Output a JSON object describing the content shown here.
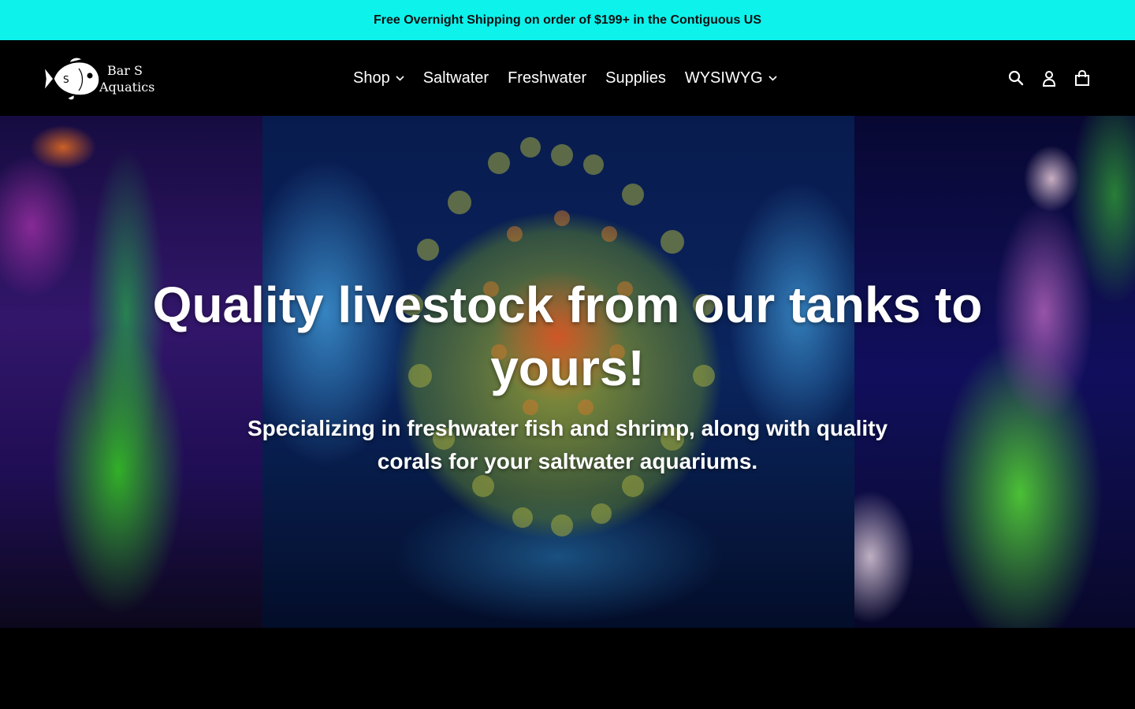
{
  "announcement": {
    "text": "Free Overnight Shipping on order of $199+ in the Contiguous US",
    "background": "#0ef2ec"
  },
  "header": {
    "logo": {
      "line1": "Bar S",
      "line2": "Aquatics",
      "icon": "fish-icon"
    },
    "nav": [
      {
        "label": "Shop",
        "has_dropdown": true
      },
      {
        "label": "Saltwater",
        "has_dropdown": false
      },
      {
        "label": "Freshwater",
        "has_dropdown": false
      },
      {
        "label": "Supplies",
        "has_dropdown": false
      },
      {
        "label": "WYSIWYG",
        "has_dropdown": true
      }
    ],
    "icons": [
      "search-icon",
      "account-icon",
      "cart-icon"
    ]
  },
  "hero": {
    "title": "Quality livestock from our tanks to yours!",
    "subtitle": "Specializing in freshwater fish and shrimp, along with quality corals for your saltwater aquariums."
  }
}
